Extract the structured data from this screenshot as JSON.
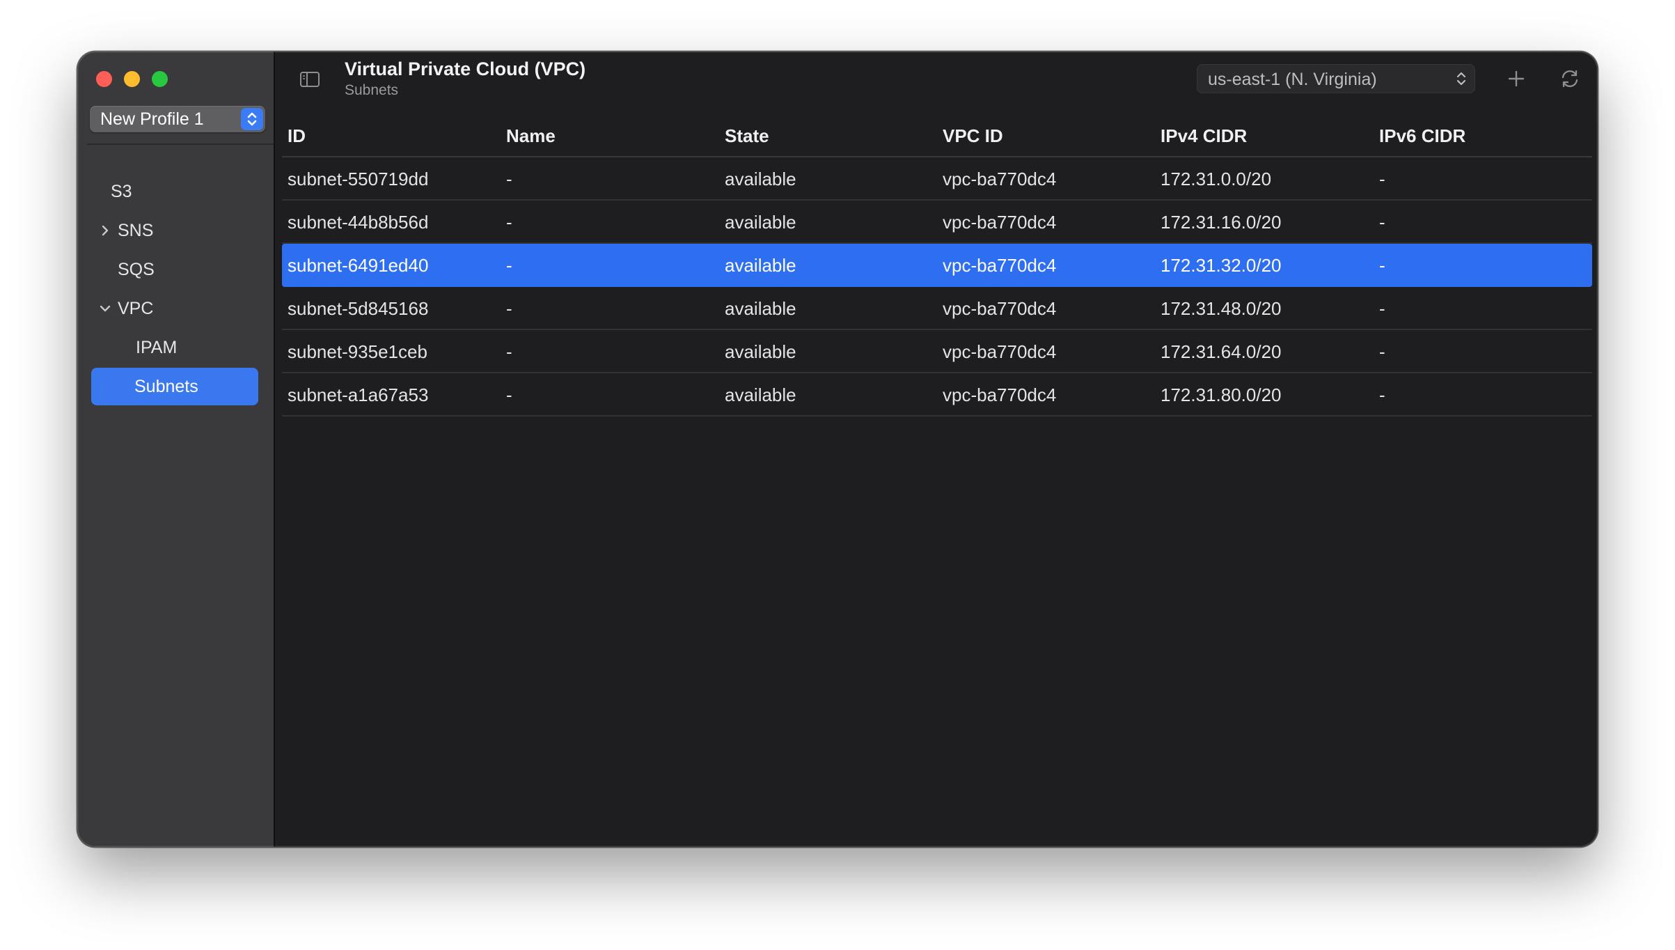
{
  "sidebar": {
    "profile": "New Profile 1",
    "items": [
      {
        "label": "S3",
        "chevron": "none",
        "selected": false
      },
      {
        "label": "SNS",
        "chevron": "chevron-right",
        "selected": false
      },
      {
        "label": "SQS",
        "chevron": "none",
        "selected": false
      },
      {
        "label": "VPC",
        "chevron": "chevron-down",
        "selected": false
      },
      {
        "label": "IPAM",
        "chevron": "none",
        "selected": false
      },
      {
        "label": "Subnets",
        "chevron": "none",
        "selected": true
      }
    ]
  },
  "header": {
    "title": "Virtual Private Cloud (VPC)",
    "subtitle": "Subnets",
    "region": "us-east-1 (N. Virginia)"
  },
  "table": {
    "columns": [
      "ID",
      "Name",
      "State",
      "VPC ID",
      "IPv4 CIDR",
      "IPv6 CIDR"
    ],
    "rows": [
      [
        "subnet-550719dd",
        "-",
        "available",
        "vpc-ba770dc4",
        "172.31.0.0/20",
        "-"
      ],
      [
        "subnet-44b8b56d",
        "-",
        "available",
        "vpc-ba770dc4",
        "172.31.16.0/20",
        "-"
      ],
      [
        "subnet-6491ed40",
        "-",
        "available",
        "vpc-ba770dc4",
        "172.31.32.0/20",
        "-"
      ],
      [
        "subnet-5d845168",
        "-",
        "available",
        "vpc-ba770dc4",
        "172.31.48.0/20",
        "-"
      ],
      [
        "subnet-935e1ceb",
        "-",
        "available",
        "vpc-ba770dc4",
        "172.31.64.0/20",
        "-"
      ],
      [
        "subnet-a1a67a53",
        "-",
        "available",
        "vpc-ba770dc4",
        "172.31.80.0/20",
        "-"
      ]
    ],
    "selected_row": 2
  },
  "colors": {
    "selection": "#2e6ff2",
    "sidebar_bg": "#3a3a3c",
    "content_bg": "#1e1e20",
    "close": "#ff5f57",
    "minimize": "#febc2e",
    "maximize": "#28c840"
  },
  "icons": {
    "sidebar_toggle": "sidebar-toggle-icon",
    "add": "plus-icon",
    "refresh": "refresh-icon",
    "region_chevron": "up-down-chevron-icon",
    "profile_chevron": "up-down-chevron-icon"
  }
}
